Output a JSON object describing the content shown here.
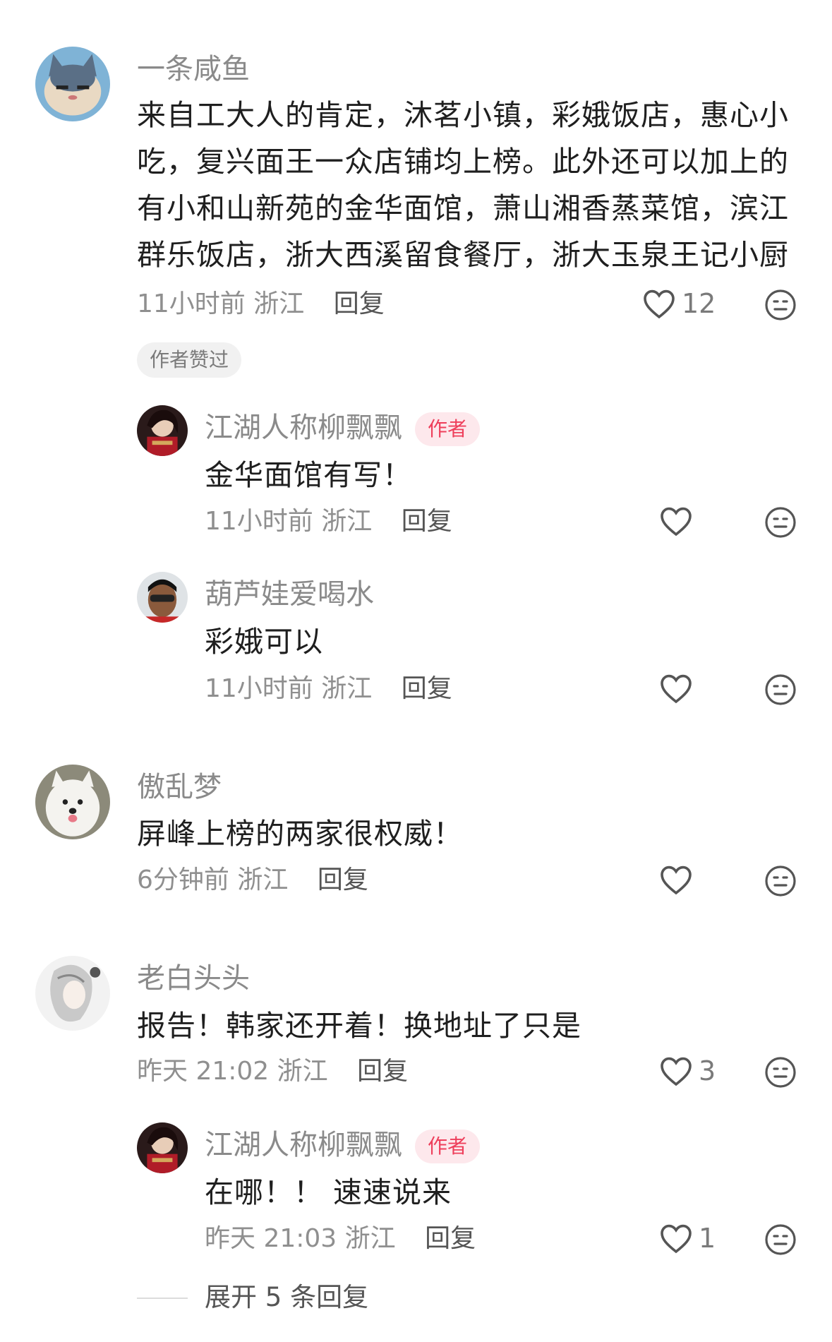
{
  "icons": {
    "like": "heart-icon",
    "dislike": "expressionless-face-icon"
  },
  "colors": {
    "author_badge_text": "#ee3f5b",
    "author_badge_bg": "#fde8ec",
    "meta": "#8f8f8f"
  },
  "comments": [
    {
      "username": "一条咸鱼",
      "lines": [
        "来自工大人的肯定，沐茗小镇，彩娥饭店，惠心小",
        "吃，复兴面王一众店铺均上榜。此外还可以加上的",
        "有小和山新苑的金华面馆，萧山湘香蒸菜馆，滨江",
        "群乐饭店，浙大西溪留食餐厅，浙大玉泉王记小厨"
      ],
      "time": "11小时前",
      "location": "浙江",
      "reply": "回复",
      "likes": "12",
      "badge": "作者赞过",
      "replies": [
        {
          "username": "江湖人称柳飘飘",
          "author_badge": "作者",
          "text": "金华面馆有写！",
          "time": "11小时前",
          "location": "浙江",
          "reply": "回复",
          "likes": ""
        },
        {
          "username": "葫芦娃爱喝水",
          "text": "彩娥可以",
          "time": "11小时前",
          "location": "浙江",
          "reply": "回复",
          "likes": ""
        }
      ]
    },
    {
      "username": "傲乱梦",
      "text": "屏峰上榜的两家很权威！",
      "time": "6分钟前",
      "location": "浙江",
      "reply": "回复",
      "likes": ""
    },
    {
      "username": "老白头头",
      "text": "报告！韩家还开着！换地址了只是",
      "time": "昨天 21:02",
      "location": "浙江",
      "reply": "回复",
      "likes": "3",
      "replies": [
        {
          "username": "江湖人称柳飘飘",
          "author_badge": "作者",
          "text": "在哪！！ 速速说来",
          "time": "昨天 21:03",
          "location": "浙江",
          "reply": "回复",
          "likes": "1"
        }
      ]
    }
  ],
  "expand_replies": "展开 5 条回复"
}
